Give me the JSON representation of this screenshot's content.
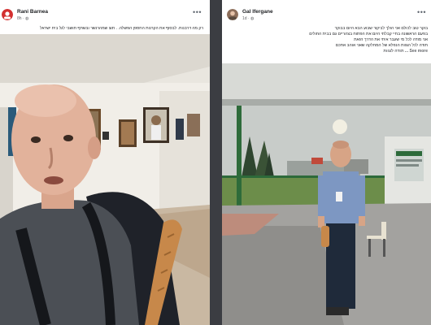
{
  "colors": {
    "page_bg": "#3b3d42",
    "card_bg": "#ffffff",
    "author_text": "#1c1e21",
    "meta_text": "#65676b"
  },
  "posts": [
    {
      "author": "Rani Barnea",
      "time": "8h",
      "audience_icon": "globe-icon",
      "caption_lines": [
        "רק מה דרבנות. לבסוף את הקרנות החספן הפשלה. . תוצ שמהרנשר ובשתף תושבי לגל בית ישראל"
      ],
      "see_more": ""
    },
    {
      "author": "Gal Ifergane",
      "time": "1d",
      "audience_icon": "globe-icon",
      "caption_lines": [
        "בוקר טוב לכולם אני הולך לביקור שבוע הבא היום בבוקר",
        "בפעם הראשונה בחיי קבלתי היום את הפתוח בצהריים גם בבית החולים",
        "אני מודה לכל מי שעבר איתי את הדרך הזאת",
        "תודה לכל הצוות הנפלא של המחלקה שאני אוהב אתכם"
      ],
      "see_more": "See more ... תודה לצוות"
    }
  ]
}
